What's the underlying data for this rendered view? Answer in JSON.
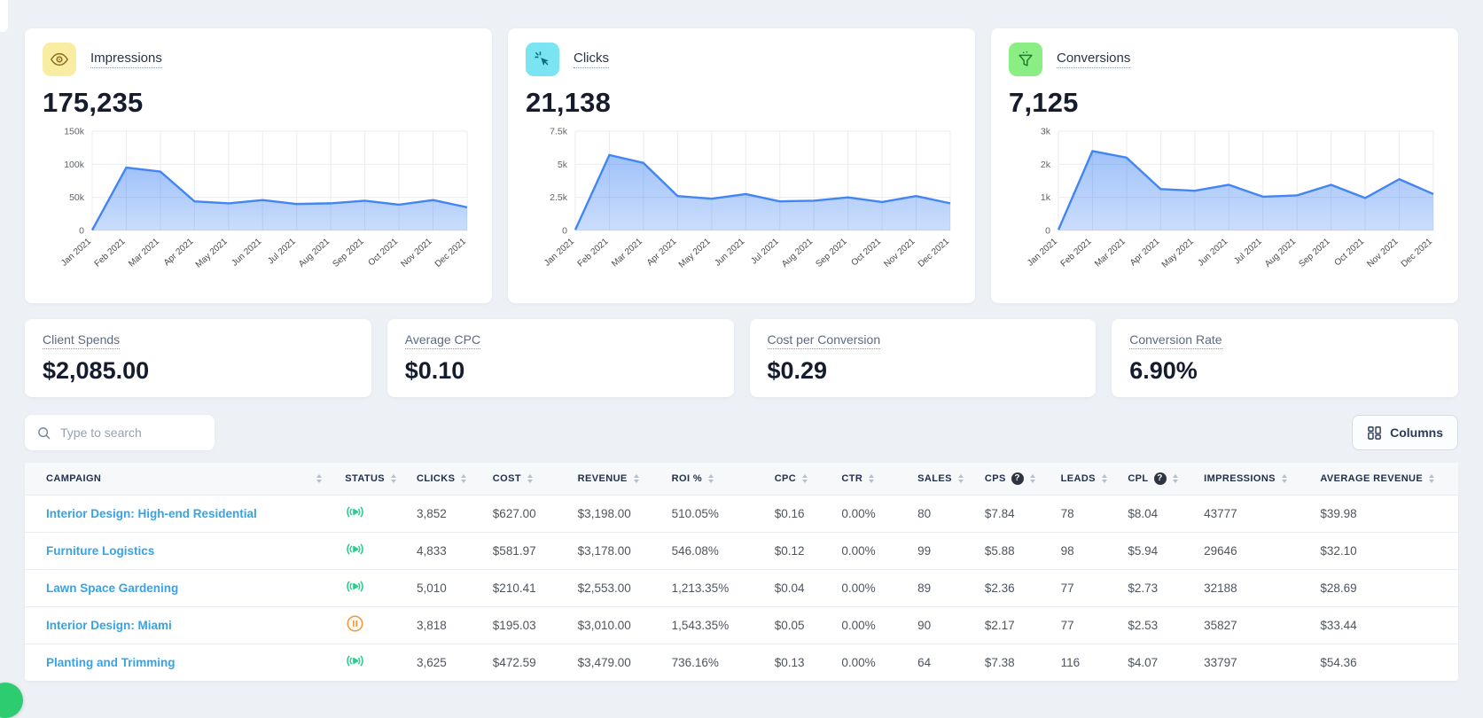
{
  "colors": {
    "chart_line": "#4285f4",
    "campaign_link": "#36a3e6",
    "status_active": "#2ecb8e",
    "status_paused": "#f59a3e",
    "impressions_icon_bg": "#f9eda4",
    "clicks_icon_bg": "#7be4f3",
    "conversions_icon_bg": "#8bee84"
  },
  "kpi_cards": [
    {
      "label": "Impressions",
      "value": "175,235",
      "icon": "eye-icon"
    },
    {
      "label": "Clicks",
      "value": "21,138",
      "icon": "cursor-click-icon"
    },
    {
      "label": "Conversions",
      "value": "7,125",
      "icon": "funnel-icon"
    }
  ],
  "chart_data": [
    {
      "type": "area",
      "title": "Impressions",
      "x": [
        "Jan 2021",
        "Feb 2021",
        "Mar 2021",
        "Apr 2021",
        "May 2021",
        "Jun 2021",
        "Jul 2021",
        "Aug 2021",
        "Sep 2021",
        "Oct 2021",
        "Nov 2021",
        "Dec 2021"
      ],
      "values": [
        500,
        95000,
        89000,
        44000,
        41000,
        46000,
        40000,
        41000,
        45000,
        39000,
        46000,
        35000
      ],
      "ylim": [
        0,
        150000
      ],
      "yticks": [
        {
          "v": 0,
          "label": "0"
        },
        {
          "v": 50000,
          "label": "50k"
        },
        {
          "v": 100000,
          "label": "100k"
        },
        {
          "v": 150000,
          "label": "150k"
        }
      ],
      "grid": true,
      "legend": "none",
      "line_color": "#4285f4"
    },
    {
      "type": "area",
      "title": "Clicks",
      "x": [
        "Jan 2021",
        "Feb 2021",
        "Mar 2021",
        "Apr 2021",
        "May 2021",
        "Jun 2021",
        "Jul 2021",
        "Aug 2021",
        "Sep 2021",
        "Oct 2021",
        "Nov 2021",
        "Dec 2021"
      ],
      "values": [
        50,
        5700,
        5100,
        2600,
        2400,
        2750,
        2200,
        2250,
        2500,
        2150,
        2600,
        2050
      ],
      "ylim": [
        0,
        7500
      ],
      "yticks": [
        {
          "v": 0,
          "label": "0"
        },
        {
          "v": 2500,
          "label": "2.5k"
        },
        {
          "v": 5000,
          "label": "5k"
        },
        {
          "v": 7500,
          "label": "7.5k"
        }
      ],
      "grid": true,
      "legend": "none",
      "line_color": "#4285f4"
    },
    {
      "type": "area",
      "title": "Conversions",
      "x": [
        "Jan 2021",
        "Feb 2021",
        "Mar 2021",
        "Apr 2021",
        "May 2021",
        "Jun 2021",
        "Jul 2021",
        "Aug 2021",
        "Sep 2021",
        "Oct 2021",
        "Nov 2021",
        "Dec 2021"
      ],
      "values": [
        20,
        2400,
        2200,
        1250,
        1200,
        1380,
        1020,
        1060,
        1380,
        980,
        1550,
        1100
      ],
      "ylim": [
        0,
        3000
      ],
      "yticks": [
        {
          "v": 0,
          "label": "0"
        },
        {
          "v": 1000,
          "label": "1k"
        },
        {
          "v": 2000,
          "label": "2k"
        },
        {
          "v": 3000,
          "label": "3k"
        }
      ],
      "grid": true,
      "legend": "none",
      "line_color": "#4285f4"
    }
  ],
  "metric_cards": [
    {
      "label": "Client Spends",
      "value": "$2,085.00"
    },
    {
      "label": "Average CPC",
      "value": "$0.10"
    },
    {
      "label": "Cost per Conversion",
      "value": "$0.29"
    },
    {
      "label": "Conversion Rate",
      "value": "6.90%"
    }
  ],
  "toolbar": {
    "search_placeholder": "Type to search",
    "columns_label": "Columns"
  },
  "table": {
    "columns": [
      {
        "key": "campaign",
        "label": "CAMPAIGN"
      },
      {
        "key": "status",
        "label": "STATUS"
      },
      {
        "key": "clicks",
        "label": "CLICKS"
      },
      {
        "key": "cost",
        "label": "COST"
      },
      {
        "key": "revenue",
        "label": "REVENUE"
      },
      {
        "key": "roi",
        "label": "ROI %"
      },
      {
        "key": "cpc",
        "label": "CPC"
      },
      {
        "key": "ctr",
        "label": "CTR"
      },
      {
        "key": "sales",
        "label": "SALES"
      },
      {
        "key": "cps",
        "label": "CPS",
        "help": true
      },
      {
        "key": "leads",
        "label": "LEADS"
      },
      {
        "key": "cpl",
        "label": "CPL",
        "help": true
      },
      {
        "key": "impressions",
        "label": "IMPRESSIONS"
      },
      {
        "key": "avg_revenue",
        "label": "AVERAGE REVENUE"
      }
    ],
    "rows": [
      {
        "campaign": "Interior Design: High-end Residential",
        "status": "active",
        "clicks": "3,852",
        "cost": "$627.00",
        "revenue": "$3,198.00",
        "roi": "510.05%",
        "cpc": "$0.16",
        "ctr": "0.00%",
        "sales": "80",
        "cps": "$7.84",
        "leads": "78",
        "cpl": "$8.04",
        "impressions": "43777",
        "avg_revenue": "$39.98"
      },
      {
        "campaign": "Furniture Logistics",
        "status": "active",
        "clicks": "4,833",
        "cost": "$581.97",
        "revenue": "$3,178.00",
        "roi": "546.08%",
        "cpc": "$0.12",
        "ctr": "0.00%",
        "sales": "99",
        "cps": "$5.88",
        "leads": "98",
        "cpl": "$5.94",
        "impressions": "29646",
        "avg_revenue": "$32.10"
      },
      {
        "campaign": "Lawn Space Gardening",
        "status": "active",
        "clicks": "5,010",
        "cost": "$210.41",
        "revenue": "$2,553.00",
        "roi": "1,213.35%",
        "cpc": "$0.04",
        "ctr": "0.00%",
        "sales": "89",
        "cps": "$2.36",
        "leads": "77",
        "cpl": "$2.73",
        "impressions": "32188",
        "avg_revenue": "$28.69"
      },
      {
        "campaign": "Interior Design: Miami",
        "status": "paused",
        "clicks": "3,818",
        "cost": "$195.03",
        "revenue": "$3,010.00",
        "roi": "1,543.35%",
        "cpc": "$0.05",
        "ctr": "0.00%",
        "sales": "90",
        "cps": "$2.17",
        "leads": "77",
        "cpl": "$2.53",
        "impressions": "35827",
        "avg_revenue": "$33.44"
      },
      {
        "campaign": "Planting and Trimming",
        "status": "active",
        "clicks": "3,625",
        "cost": "$472.59",
        "revenue": "$3,479.00",
        "roi": "736.16%",
        "cpc": "$0.13",
        "ctr": "0.00%",
        "sales": "64",
        "cps": "$7.38",
        "leads": "116",
        "cpl": "$4.07",
        "impressions": "33797",
        "avg_revenue": "$54.36"
      }
    ]
  }
}
